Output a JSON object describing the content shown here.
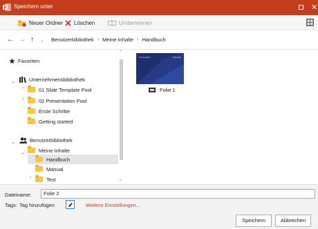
{
  "window": {
    "title": "Speichern unter",
    "accent": "#c43e1c"
  },
  "toolbar": {
    "new_folder": "Neuer Ordner",
    "delete": "Löschen",
    "rename": "Umbenennen"
  },
  "breadcrumb": [
    "Benutzerbibliothek",
    "Meine Inhalte",
    "Handbuch"
  ],
  "tree": {
    "favorites": "Favoriten",
    "company_library": "Unternehmensbibliothek",
    "company_items": [
      "01 Slide Template Pool",
      "02 Presentation Pool",
      "Erste Schritte",
      "Getting started"
    ],
    "user_library": "Benutzerbibliothek",
    "my_content": "Meine Inhalte",
    "my_items": [
      "Handbuch",
      "Manual",
      "Test"
    ]
  },
  "files": [
    {
      "name": "Folie 1",
      "thumb_title": "Presentation",
      "thumb_subtitle": "corporate"
    }
  ],
  "footer": {
    "filename_label": "Dateiname:",
    "filename_value": "Folie 2",
    "tags_label": "Tags:",
    "tags_value": "Tag hinzufügen",
    "more_settings": "Weitere Einstellungen...",
    "save": "Speichern",
    "cancel": "Abbrechen"
  },
  "icons": {
    "app": "powerpoint-icon",
    "new_folder": "new-folder-icon",
    "delete": "delete-x-icon",
    "rename": "rename-icon",
    "back": "back-arrow-icon",
    "forward": "forward-arrow-icon",
    "up": "up-arrow-icon",
    "favorites": "star-icon",
    "library": "library-icon",
    "user": "users-icon",
    "edit": "pencil-icon"
  }
}
